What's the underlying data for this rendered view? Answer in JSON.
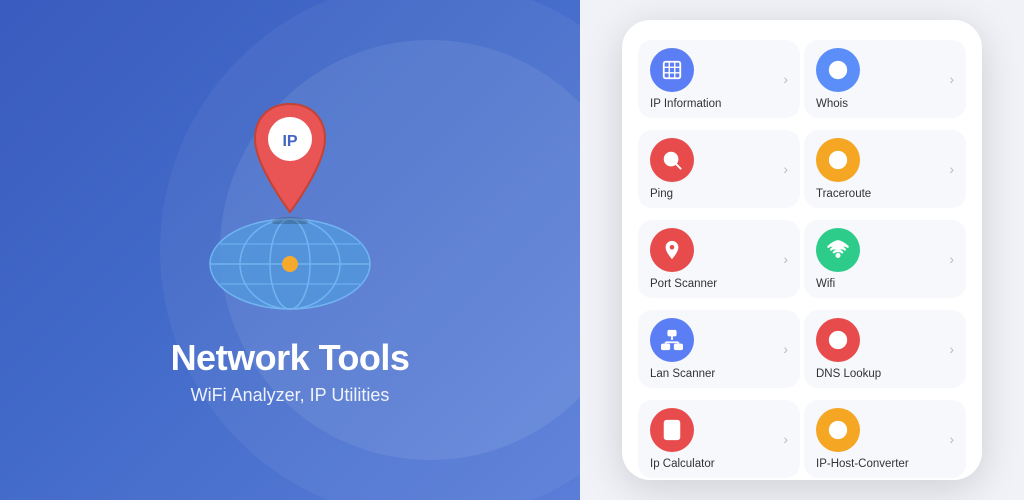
{
  "left": {
    "title": "Network Tools",
    "subtitle": "WiFi Analyzer, IP Utilities"
  },
  "right": {
    "tools": [
      [
        {
          "id": "ip-information",
          "label": "IP Information",
          "icon": "ip",
          "color": "icon-blue"
        },
        {
          "id": "whois",
          "label": "Whois",
          "icon": "whois",
          "color": "icon-blue2"
        }
      ],
      [
        {
          "id": "ping",
          "label": "Ping",
          "icon": "ping",
          "color": "icon-red"
        },
        {
          "id": "traceroute",
          "label": "Traceroute",
          "icon": "traceroute",
          "color": "icon-orange"
        }
      ],
      [
        {
          "id": "port-scanner",
          "label": "Port Scanner",
          "icon": "port",
          "color": "icon-red2"
        },
        {
          "id": "wifi",
          "label": "Wifi",
          "icon": "wifi",
          "color": "icon-green"
        }
      ],
      [
        {
          "id": "lan-scanner",
          "label": "Lan Scanner",
          "icon": "lan",
          "color": "icon-blue3"
        },
        {
          "id": "dns-lookup",
          "label": "DNS Lookup",
          "icon": "dns",
          "color": "icon-red3"
        }
      ],
      [
        {
          "id": "ip-calculator",
          "label": "Ip Calculator",
          "icon": "calc",
          "color": "icon-red4"
        },
        {
          "id": "ip-host-converter",
          "label": "IP-Host-Converter",
          "icon": "converter",
          "color": "icon-orange2"
        }
      ]
    ],
    "chevron": "›"
  }
}
